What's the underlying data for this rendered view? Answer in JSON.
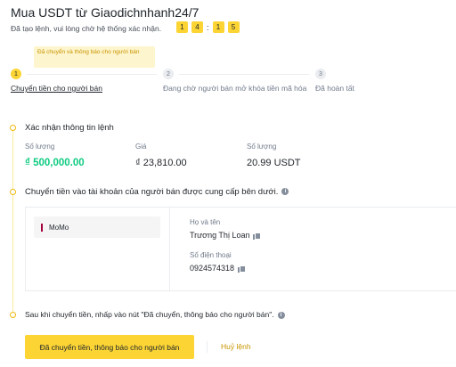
{
  "header": {
    "title": "Mua USDT từ Giaodichnhanh24/7",
    "subtitle": "Đã tạo lệnh, vui lòng chờ hệ thống xác nhận.",
    "timer": [
      "1",
      "4",
      "1",
      "5"
    ],
    "timer_sep": ":"
  },
  "tooltip": "Đã chuyển và thông báo cho người bán",
  "steps": [
    {
      "num": "1",
      "label": "Chuyển tiền cho người bán"
    },
    {
      "num": "2",
      "label": "Đang chờ người bán mở khóa tiền mã hóa"
    },
    {
      "num": "3",
      "label": "Đã hoàn tất"
    }
  ],
  "order_info": {
    "title": "Xác nhận thông tin lệnh",
    "amount_label": "Số lượng",
    "amount_value": "₫ 500,000.00",
    "price_label": "Giá",
    "price_value": "₫ 23,810.00",
    "qty_label": "Số lượng",
    "qty_value": "20.99 USDT"
  },
  "transfer": {
    "title": "Chuyển tiền vào tài khoản của người bán được cung cấp bên dưới.",
    "method": "MoMo",
    "name_label": "Họ và tên",
    "name_value": "Trương Thị Loan",
    "phone_label": "Số điện thoại",
    "phone_value": "0924574318"
  },
  "confirm": {
    "title": "Sau khi chuyển tiền, nhấp vào nút \"Đã chuyển, thông báo cho người bán\".",
    "primary_button": "Đã chuyển tiền, thông báo cho người bán",
    "cancel_button": "Huỷ lệnh"
  },
  "colors": {
    "accent": "#fcd535",
    "green": "#0ecb81",
    "link": "#c99400",
    "momo": "#a5003b"
  }
}
